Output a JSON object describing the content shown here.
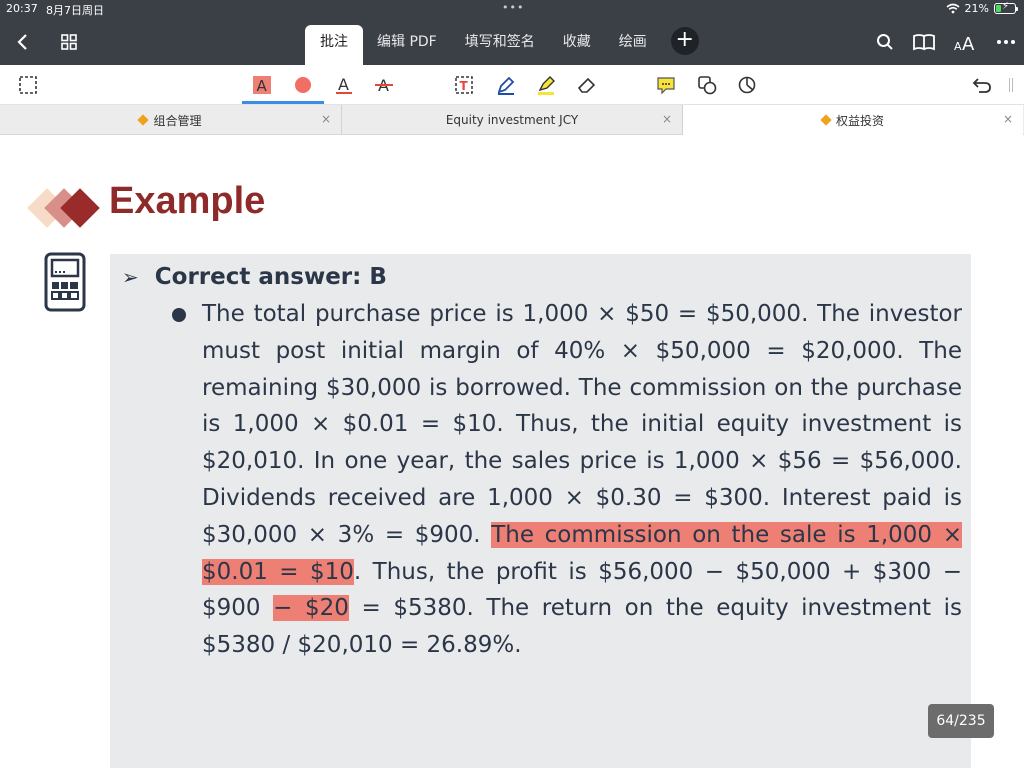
{
  "status": {
    "time": "20:37",
    "date": "8月7日周日",
    "battery": "21%"
  },
  "nav": {
    "tabs": [
      {
        "label": "批注",
        "active": true
      },
      {
        "label": "编辑 PDF"
      },
      {
        "label": "填写和签名"
      },
      {
        "label": "收藏"
      },
      {
        "label": "绘画"
      }
    ],
    "add_symbol": "+"
  },
  "doc_tabs": [
    {
      "label": "组合管理",
      "close": "×"
    },
    {
      "label": "Equity investment JCY",
      "close": "×"
    },
    {
      "label": "权益投资",
      "close": "×"
    }
  ],
  "slide": {
    "title": "Example",
    "answer": "Correct answer: B",
    "para": {
      "t1": "The total purchase price is 1,000 × $50 = $50,000. The investor must post initial margin of 40% × $50,000 = $20,000. The remaining $30,000 is borrowed. The commission on the purchase is 1,000 × $0.01 = $10. Thus, the initial equity investment is $20,010. In one year, the sales price is 1,000 × $56 = $56,000. Dividends received are 1,000 × $0.30 = $300. Interest paid is $30,000 × 3% = $900. ",
      "h1": "The commission on the sale is 1,000 × $0.01 = $10",
      "t2": ". Thus, the profit is $56,000 − $50,000 + $300 − $900 ",
      "h2": "− $20",
      "t3": " = $5380. The return on the equity investment is $5380 / $20,010  = 26.89%."
    }
  },
  "page_indicator": "64/235",
  "colors": {
    "highlight": "#ee7f74",
    "title": "#8e2a2a",
    "accent": "#3a8ee6"
  }
}
